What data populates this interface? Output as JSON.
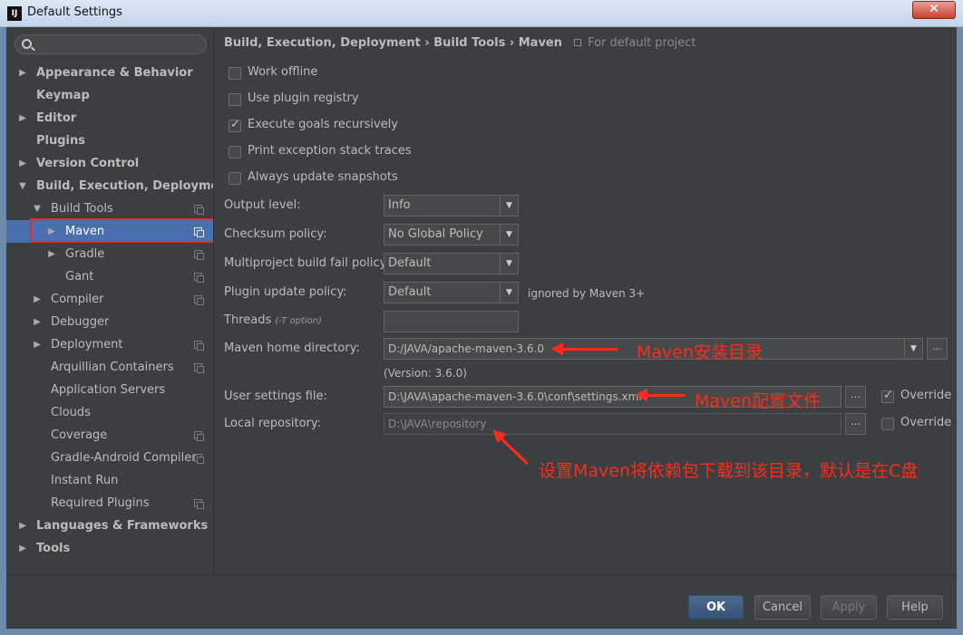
{
  "window": {
    "title": "Default Settings",
    "icon": "intellij-icon",
    "close_label": "✕"
  },
  "search": {
    "placeholder": ""
  },
  "sidebar": {
    "items": [
      {
        "label": "Appearance & Behavior",
        "arrow": "▶"
      },
      {
        "label": "Keymap",
        "arrow": ""
      },
      {
        "label": "Editor",
        "arrow": "▶"
      },
      {
        "label": "Plugins",
        "arrow": ""
      },
      {
        "label": "Version Control",
        "arrow": "▶"
      },
      {
        "label": "Build, Execution, Deployment",
        "arrow": "▼"
      },
      {
        "label": "Build Tools",
        "arrow": "▼"
      },
      {
        "label": "Maven",
        "arrow": "▶",
        "selected": true
      },
      {
        "label": "Gradle",
        "arrow": "▶"
      },
      {
        "label": "Gant",
        "arrow": ""
      },
      {
        "label": "Compiler",
        "arrow": "▶"
      },
      {
        "label": "Debugger",
        "arrow": "▶"
      },
      {
        "label": "Deployment",
        "arrow": "▶"
      },
      {
        "label": "Arquillian Containers",
        "arrow": ""
      },
      {
        "label": "Application Servers",
        "arrow": ""
      },
      {
        "label": "Clouds",
        "arrow": ""
      },
      {
        "label": "Coverage",
        "arrow": ""
      },
      {
        "label": "Gradle-Android Compiler",
        "arrow": ""
      },
      {
        "label": "Instant Run",
        "arrow": ""
      },
      {
        "label": "Required Plugins",
        "arrow": ""
      },
      {
        "label": "Languages & Frameworks",
        "arrow": "▶"
      },
      {
        "label": "Tools",
        "arrow": "▶"
      }
    ]
  },
  "breadcrumb": {
    "path": "Build, Execution, Deployment › Build Tools › Maven",
    "scope": "For default project"
  },
  "options": {
    "work_offline": {
      "label": "Work offline",
      "checked": false
    },
    "use_plugin_registry": {
      "label": "Use plugin registry",
      "checked": false
    },
    "execute_goals_recursively": {
      "label": "Execute goals recursively",
      "checked": true
    },
    "print_exception_stack_traces": {
      "label": "Print exception stack traces",
      "checked": false
    },
    "always_update_snapshots": {
      "label": "Always update snapshots",
      "checked": false
    }
  },
  "form": {
    "output_level": {
      "label": "Output level:",
      "value": "Info"
    },
    "checksum_policy": {
      "label": "Checksum policy:",
      "value": "No Global Policy"
    },
    "multiproject_fail_policy": {
      "label": "Multiproject build fail policy:",
      "value": "Default"
    },
    "plugin_update_policy": {
      "label": "Plugin update policy:",
      "value": "Default",
      "note": "ignored by Maven 3+"
    },
    "threads": {
      "label": "Threads",
      "hint": "(-T option)",
      "value": ""
    },
    "maven_home": {
      "label": "Maven home directory:",
      "value": "D:/JAVA/apache-maven-3.6.0",
      "version": "(Version: 3.6.0)"
    },
    "user_settings": {
      "label": "User settings file:",
      "value": "D:\\JAVA\\apache-maven-3.6.0\\conf\\settings.xml",
      "override_label": "Override",
      "override_checked": true
    },
    "local_repo": {
      "label": "Local repository:",
      "value": "D:\\JAVA\\repository",
      "override_label": "Override",
      "override_checked": false
    },
    "browse_label": "..."
  },
  "annotations": {
    "maven_home_note": "Maven安装目录",
    "settings_note": "Maven配置文件",
    "repo_note": "设置Maven将依赖包下载到该目录，默认是在C盘"
  },
  "buttons": {
    "ok": "OK",
    "cancel": "Cancel",
    "apply": "Apply",
    "help": "Help"
  },
  "colors": {
    "panel": "#3c3f41",
    "selection": "#4b6eaf",
    "annotation": "#ff2a1a",
    "highlight_box": "#e52a2a"
  }
}
